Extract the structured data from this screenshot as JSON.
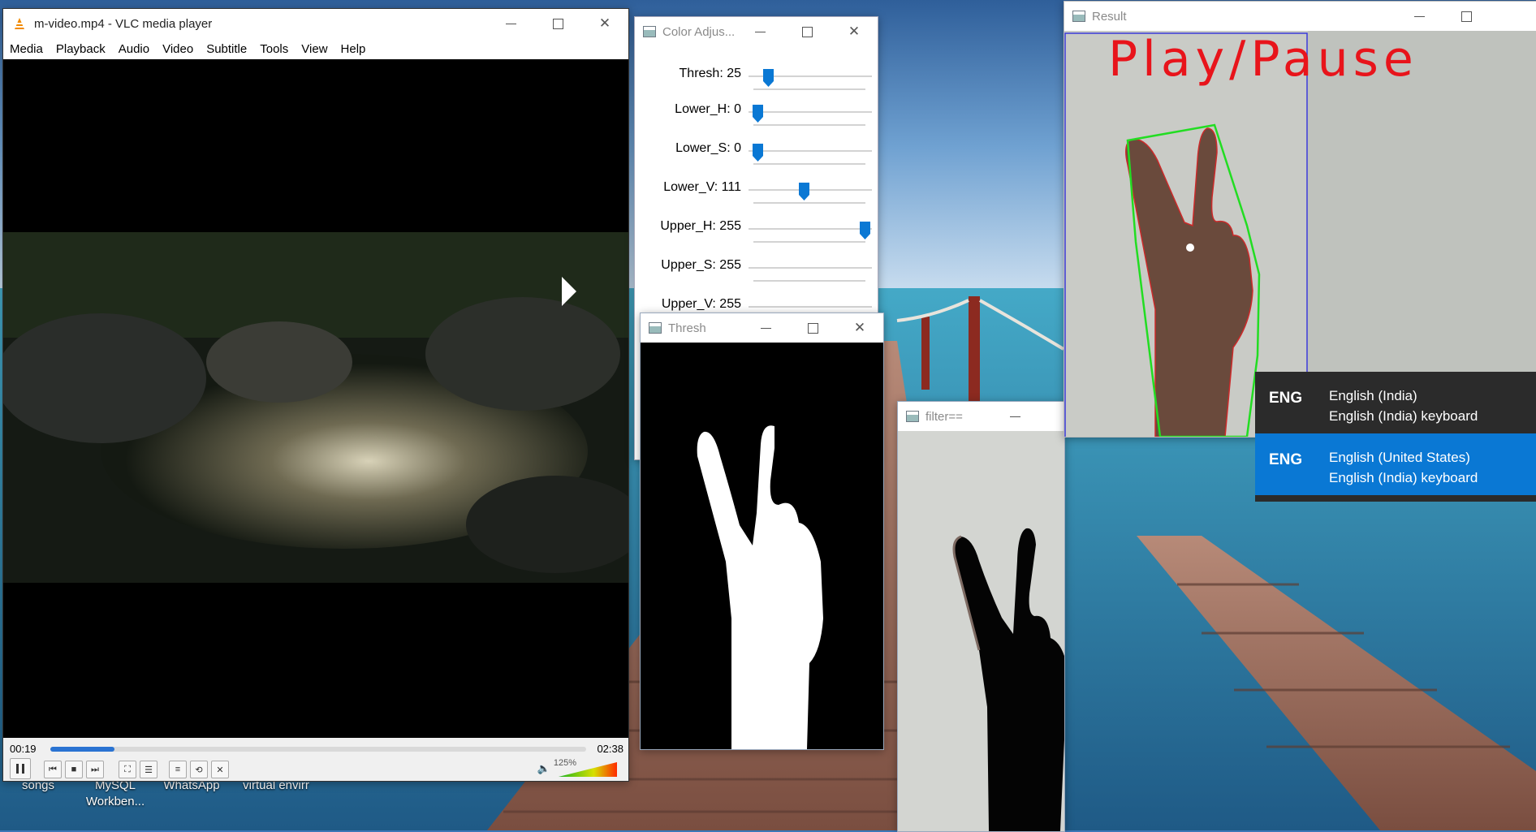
{
  "desktop": {
    "icons": [
      "songs",
      "MySQL Workben...",
      "WhatsApp",
      "virtual envirr"
    ]
  },
  "vlc": {
    "title": "m-video.mp4 - VLC media player",
    "menu": [
      "Media",
      "Playback",
      "Audio",
      "Video",
      "Subtitle",
      "Tools",
      "View",
      "Help"
    ],
    "time_elapsed": "00:19",
    "time_total": "02:38",
    "progress": 0.12,
    "volume_label": "125%",
    "volume": 1.25
  },
  "color_adjust": {
    "title": "Color Adjus...",
    "sliders": [
      {
        "label": "Thresh: 25",
        "fraction": 0.1
      },
      {
        "label": "Lower_H: 0",
        "fraction": 0.0
      },
      {
        "label": "Lower_S: 0",
        "fraction": 0.0
      },
      {
        "label": "Lower_V: 111",
        "fraction": 0.435
      },
      {
        "label": "Upper_H: 255",
        "fraction": 1.0
      },
      {
        "label": "Upper_S: 255",
        "fraction": 1.0
      },
      {
        "label": "Upper_V: 255",
        "fraction": 1.0
      }
    ]
  },
  "thresh": {
    "title": "Thresh"
  },
  "filter": {
    "title": "filter=="
  },
  "result": {
    "title": "Result",
    "overlay_text": "Play/Pause"
  },
  "language_flyout": {
    "items": [
      {
        "code": "ENG",
        "language": "English (India)",
        "keyboard": "English (India) keyboard",
        "active": false
      },
      {
        "code": "ENG",
        "language": "English (United States)",
        "keyboard": "English (India) keyboard",
        "active": true
      }
    ]
  },
  "colors": {
    "accent": "#0a78d4",
    "overlay_text": "#e8141b",
    "contour": "#22dd22"
  }
}
